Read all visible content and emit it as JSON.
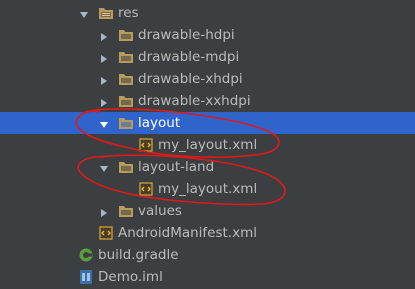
{
  "project_tree": {
    "items": [
      {
        "label": "res",
        "depth": 3,
        "expander": "expanded",
        "icon": "folder-res-icon"
      },
      {
        "label": "drawable-hdpi",
        "depth": 4,
        "expander": "collapsed",
        "icon": "folder-icon"
      },
      {
        "label": "drawable-mdpi",
        "depth": 4,
        "expander": "collapsed",
        "icon": "folder-icon"
      },
      {
        "label": "drawable-xhdpi",
        "depth": 4,
        "expander": "collapsed",
        "icon": "folder-icon"
      },
      {
        "label": "drawable-xxhdpi",
        "depth": 4,
        "expander": "collapsed",
        "icon": "folder-icon"
      },
      {
        "label": "layout",
        "depth": 4,
        "expander": "expanded",
        "icon": "folder-icon",
        "selected": true
      },
      {
        "label": "my_layout.xml",
        "depth": 5,
        "expander": "none",
        "icon": "xml-file-icon"
      },
      {
        "label": "layout-land",
        "depth": 4,
        "expander": "expanded",
        "icon": "folder-icon"
      },
      {
        "label": "my_layout.xml",
        "depth": 5,
        "expander": "none",
        "icon": "xml-file-icon"
      },
      {
        "label": "values",
        "depth": 4,
        "expander": "collapsed",
        "icon": "folder-icon"
      },
      {
        "label": "AndroidManifest.xml",
        "depth": 3,
        "expander": "none",
        "icon": "manifest-file-icon"
      },
      {
        "label": "build.gradle",
        "depth": 2,
        "expander": "none",
        "icon": "gradle-file-icon"
      },
      {
        "label": "Demo.iml",
        "depth": 2,
        "expander": "none",
        "icon": "iml-file-icon"
      }
    ]
  },
  "colors": {
    "background": "#3c3f41",
    "text": "#bbbbbb",
    "selection": "#2f65ca",
    "selected_text": "#ffffff",
    "folder": "#b89a5b",
    "annotation": "#e0191c"
  }
}
